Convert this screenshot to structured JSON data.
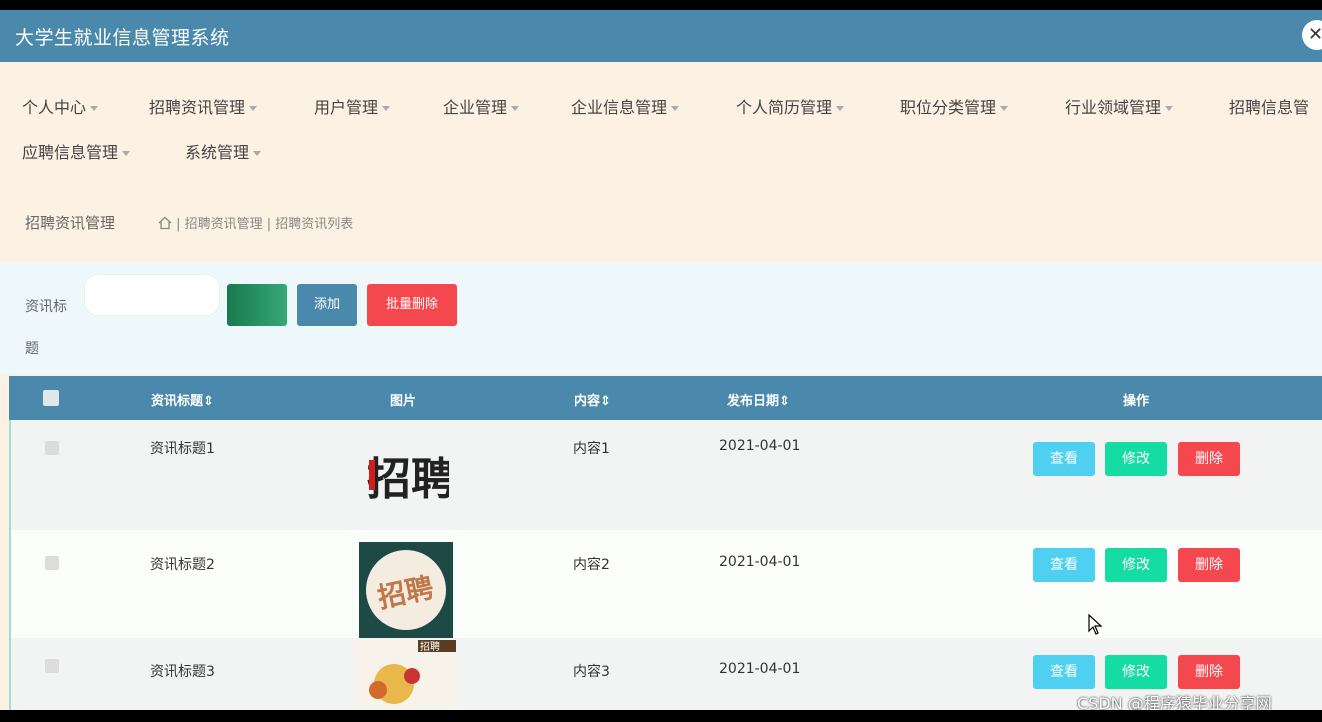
{
  "app": {
    "title": "大学生就业信息管理系统",
    "close_icon": "✕"
  },
  "menu": {
    "items": [
      {
        "label": "个人中心"
      },
      {
        "label": "招聘资讯管理"
      },
      {
        "label": "用户管理"
      },
      {
        "label": "企业管理"
      },
      {
        "label": "企业信息管理"
      },
      {
        "label": "个人简历管理"
      },
      {
        "label": "职位分类管理"
      },
      {
        "label": "行业领域管理"
      },
      {
        "label": "招聘信息管"
      },
      {
        "label": "应聘信息管理"
      },
      {
        "label": "系统管理"
      }
    ]
  },
  "breadcrumb": {
    "title": "招聘资讯管理",
    "path": "| 招聘资讯管理 | 招聘资讯列表"
  },
  "search": {
    "label": "资讯标题",
    "input_value": "",
    "search_label": "",
    "add_label": "添加",
    "batch_delete_label": "批量删除"
  },
  "table": {
    "headers": {
      "title": "资讯标题",
      "image": "图片",
      "content": "内容",
      "date": "发布日期",
      "actions": "操作"
    },
    "rows": [
      {
        "title": "资讯标题1",
        "content": "内容1",
        "date": "2021-04-01",
        "image_text": "招聘"
      },
      {
        "title": "资讯标题2",
        "content": "内容2",
        "date": "2021-04-01",
        "image_text": "招聘"
      },
      {
        "title": "资讯标题3",
        "content": "内容3",
        "date": "2021-04-01",
        "image_text": "招聘"
      }
    ],
    "action_labels": {
      "view": "查看",
      "edit": "修改",
      "delete": "删除"
    }
  },
  "watermark": "CSDN @程序猿毕业分享网",
  "colors": {
    "header_bg": "#4a89ab",
    "danger": "#f5484e",
    "info": "#4fd0f0",
    "success": "#15dca2"
  }
}
